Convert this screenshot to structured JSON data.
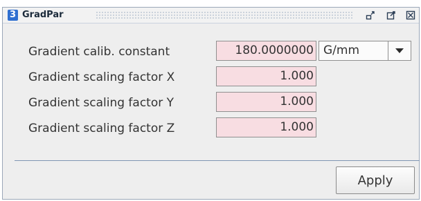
{
  "window": {
    "badge": "3",
    "title": "GradPar",
    "controls": [
      "restore-icon",
      "maximize-icon",
      "close-icon"
    ]
  },
  "form": {
    "rows": [
      {
        "label": "Gradient calib. constant",
        "value": "180.0000000"
      },
      {
        "label": "Gradient scaling factor X",
        "value": "1.000"
      },
      {
        "label": "Gradient scaling factor Y",
        "value": "1.000"
      },
      {
        "label": "Gradient scaling factor Z",
        "value": "1.000"
      }
    ],
    "unit": {
      "selected": "G/mm",
      "icon": "chevron-down-icon"
    }
  },
  "actions": {
    "apply_label": "Apply"
  },
  "colors": {
    "badge_bg": "#2f6fd0",
    "field_bg": "#f8dde2",
    "divider": "#7f95b3"
  }
}
